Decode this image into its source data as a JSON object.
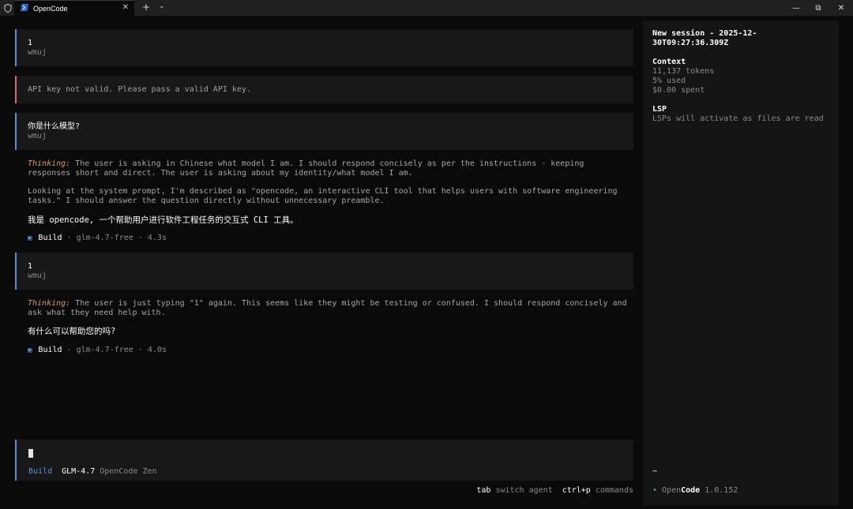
{
  "window": {
    "tab_title": "OpenCode",
    "new_tab": "+",
    "dropdown": "⌄",
    "minimize": "—",
    "maximize": "⧉",
    "close": "✕",
    "tab_close": "✕"
  },
  "messages": [
    {
      "type": "user",
      "text": "1",
      "user": "wmuj"
    },
    {
      "type": "error",
      "text": "API key not valid. Please pass a valid API key."
    },
    {
      "type": "user",
      "text": "你是什么模型?",
      "user": "wmuj"
    },
    {
      "type": "assistant",
      "thinking_label": "Thinking:",
      "thinking_p1": "The user is asking in Chinese what model I am. I should respond concisely as per the instructions - keeping responses short and direct. The user is asking about my identity/what model I am.",
      "thinking_p2": "Looking at the system prompt, I'm described as \"opencode, an interactive CLI tool that helps users with software engineering tasks.\" I should answer the question directly without unnecessary preamble.",
      "answer": "我是 opencode, 一个帮助用户进行软件工程任务的交互式 CLI 工具。",
      "meta_icon": "▣",
      "agent": "Build",
      "details": "· glm-4.7-free · 4.3s"
    },
    {
      "type": "user",
      "text": "1",
      "user": "wmuj"
    },
    {
      "type": "assistant",
      "thinking_label": "Thinking:",
      "thinking_p1": "The user is just typing \"1\" again. This seems like they might be testing or confused. I should respond concisely and ask what they need help with.",
      "answer": "有什么可以帮助您的吗?",
      "meta_icon": "▣",
      "agent": "Build",
      "details": "· glm-4.7-free · 4.0s"
    }
  ],
  "input": {
    "agent": "Build",
    "model": "GLM-4.7",
    "provider": "OpenCode Zen"
  },
  "hints": {
    "tab_key": "tab",
    "tab_desc": "switch agent",
    "cmd_key": "ctrl+p",
    "cmd_desc": "commands"
  },
  "sidebar": {
    "title": "New session - 2025-12-30T09:27:36.309Z",
    "context_heading": "Context",
    "tokens": "11,137 tokens",
    "used": "5% used",
    "spent": "$0.00 spent",
    "lsp_heading": "LSP",
    "lsp_text": "LSPs will activate as files are read",
    "tilde": "~",
    "footer_dot": "•",
    "footer_open": "Open",
    "footer_code": "Code",
    "version": "1.0.152"
  }
}
